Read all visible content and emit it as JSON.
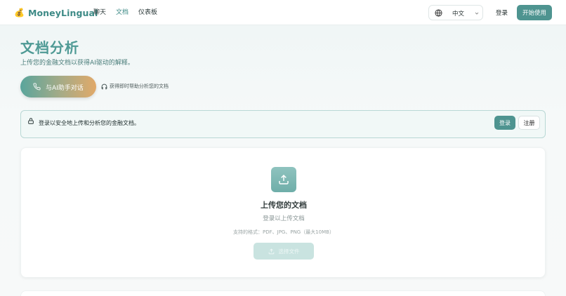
{
  "nav": {
    "brand_icon": "💰",
    "brand_name": "MoneyLingual",
    "links": [
      "聊天",
      "文档",
      "仪表板"
    ],
    "active_link": "文档",
    "language": "中文",
    "login": "登录",
    "start": "开始使用"
  },
  "header": {
    "title": "文档分析",
    "subtitle": "上传您的金融文档以获得AI驱动的解释。",
    "chat_button": "与AI助手对话",
    "help_text": "获得即时帮助分析您的文档"
  },
  "notice": {
    "text": "登录以安全地上传和分析您的金融文档。",
    "login": "登录",
    "register": "注册"
  },
  "upload": {
    "title": "上传您的文档",
    "subtitle": "登录以上传文档",
    "formats": "支持的格式：PDF、JPG、PNG（最大10MB）",
    "choose_button": "选择文件"
  },
  "colors": {
    "accent": "#4e9490",
    "title": "#4f9a95",
    "notice_border": "#b9d8d5"
  },
  "icons": [
    "globe-icon",
    "chevron-down-icon",
    "phone-icon",
    "headphones-icon",
    "lock-icon",
    "upload-icon"
  ]
}
